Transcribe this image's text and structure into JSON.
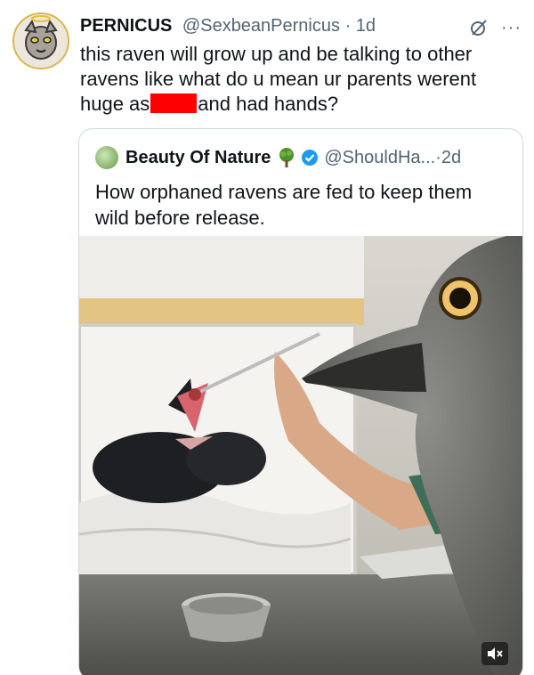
{
  "tweet": {
    "author_name": "PERNICUS",
    "author_handle": "@SexbeanPernicus",
    "separator": "·",
    "time": "1d",
    "more": "···",
    "text_part1": "this raven will grow up and be talking to other ravens like what do u mean ur parents werent huge as",
    "text_part2": "and had hands?"
  },
  "quote": {
    "author_name": "Beauty Of Nature",
    "author_handle": "@ShouldHa...",
    "separator": "·",
    "time": "2d",
    "text": "How orphaned ravens are fed to keep them wild before release."
  },
  "media": {
    "box_label": "baby",
    "mute_icon": "mute-speaker-icon"
  },
  "colors": {
    "redaction": "#ff0000",
    "verified": "#1d9bf0",
    "secondary_text": "#536471"
  }
}
